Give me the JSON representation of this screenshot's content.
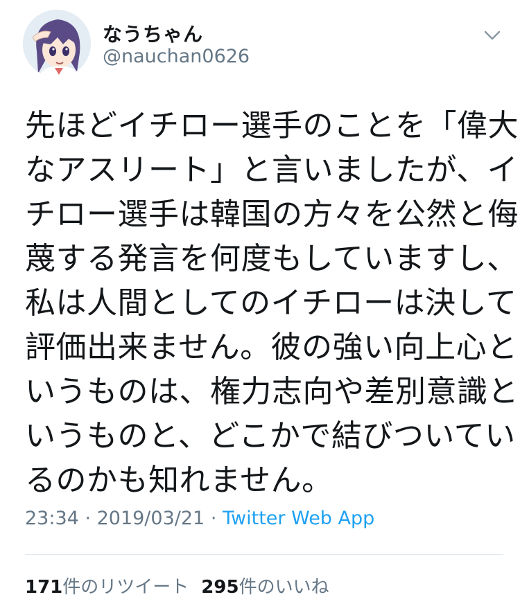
{
  "user": {
    "display_name": "なうちゃん",
    "handle": "@nauchan0626"
  },
  "icons": {
    "avatar": "anime-girl-saluting-avatar",
    "caret": "chevron-down-icon"
  },
  "tweet": {
    "text_lines": [
      "先ほどイチロー選手のことを「偉大",
      "なアスリート」と言いましたが、イ",
      "チロー選手は韓国の方々を公然と侮",
      "蔑する発言を何度もしていますし、",
      "私は人間としてのイチローは決して",
      "評価出来ません。彼の強い向上心と",
      "いうものは、権力志向や差別意識と",
      "いうものと、どこかで結びついてい",
      "るのかも知れません。"
    ],
    "time": "23:34",
    "date": "2019/03/21",
    "separator": "·",
    "source": "Twitter Web App"
  },
  "stats": {
    "retweets_count": "171",
    "retweets_label": "件のリツイート",
    "likes_count": "295",
    "likes_label": "件のいいね"
  },
  "colors": {
    "text": "#14171a",
    "secondary": "#657786",
    "link": "#1da1f2",
    "divider": "#e1e8ed"
  }
}
